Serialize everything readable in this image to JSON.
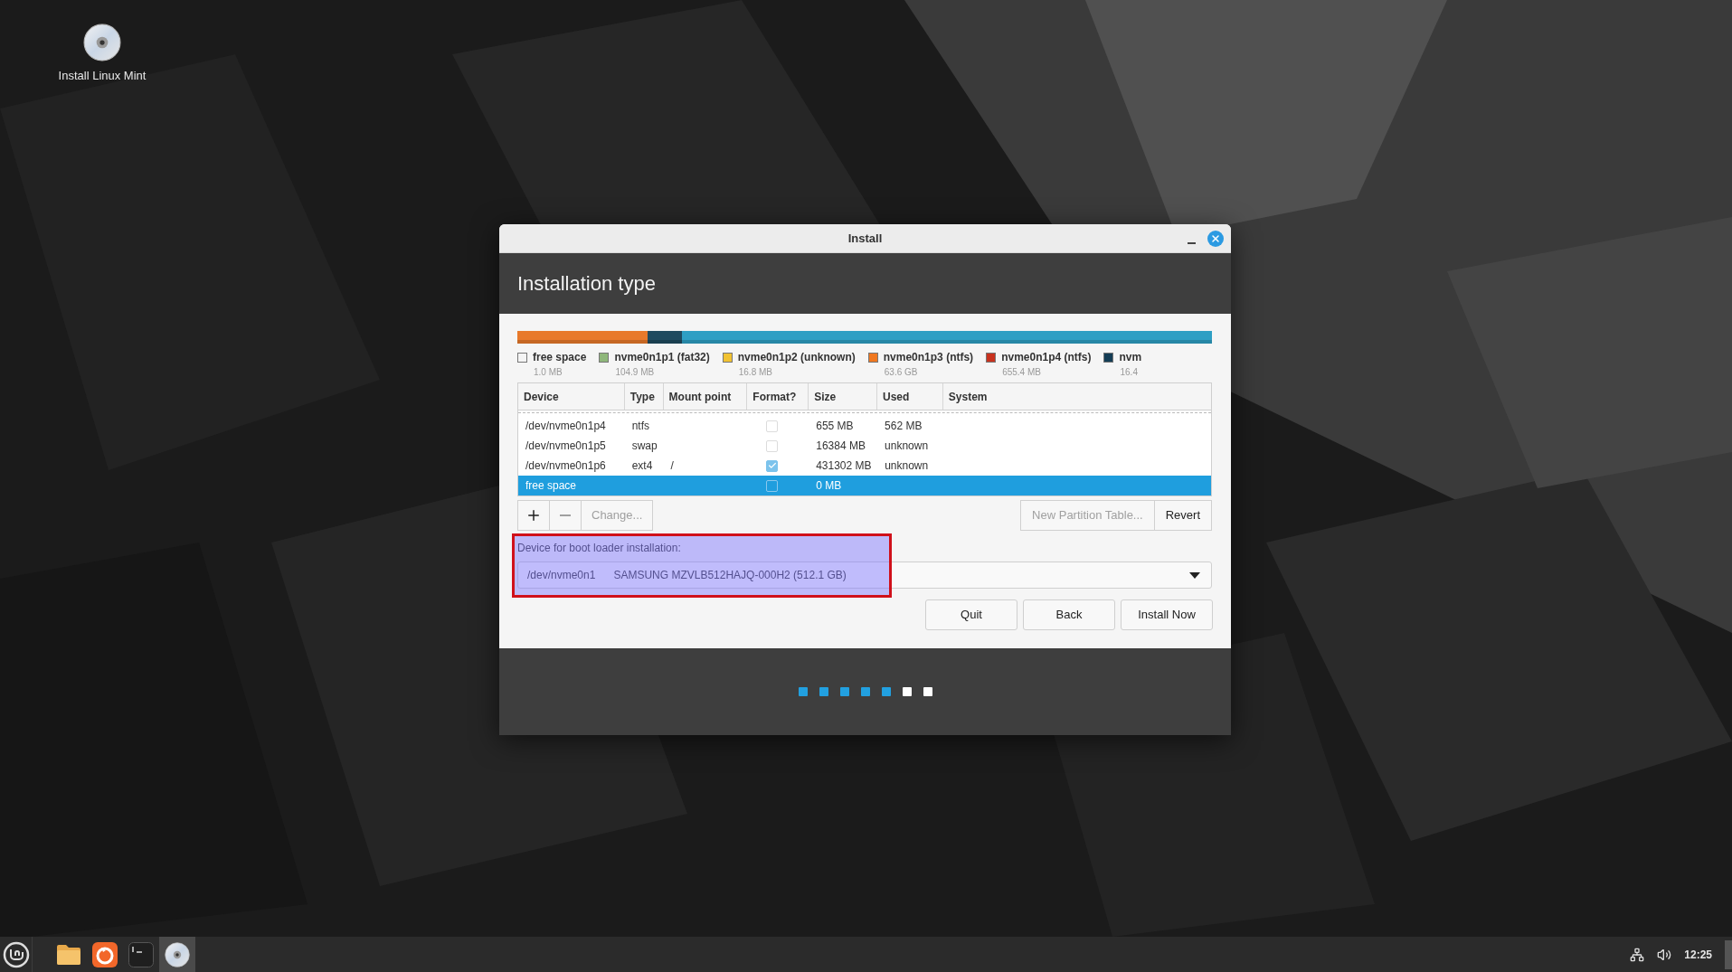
{
  "desktop": {
    "icons": [
      {
        "label": "Install Linux Mint"
      }
    ]
  },
  "window": {
    "title": "Install",
    "heading": "Installation type"
  },
  "legend": [
    {
      "name": "free space",
      "size": "1.0 MB",
      "color": "#f4f4f4"
    },
    {
      "name": "nvme0n1p1 (fat32)",
      "size": "104.9 MB",
      "color": "#8fb77b"
    },
    {
      "name": "nvme0n1p2 (unknown)",
      "size": "16.8 MB",
      "color": "#f1c232"
    },
    {
      "name": "nvme0n1p3 (ntfs)",
      "size": "63.6 GB",
      "color": "#f07820"
    },
    {
      "name": "nvme0n1p4 (ntfs)",
      "size": "655.4 MB",
      "color": "#c8321e"
    },
    {
      "name": "nvm",
      "size": "16.4",
      "color": "#143d55"
    }
  ],
  "table": {
    "columns": [
      "Device",
      "Type",
      "Mount point",
      "Format?",
      "Size",
      "Used",
      "System"
    ],
    "rows": [
      {
        "device": "/dev/nvme0n1p4",
        "type": "ntfs",
        "format": false,
        "size": "655 MB",
        "used": "562 MB",
        "selected": false
      },
      {
        "device": "/dev/nvme0n1p5",
        "type": "swap",
        "format": false,
        "size": "16384 MB",
        "used": "unknown",
        "selected": false
      },
      {
        "device": "/dev/nvme0n1p6",
        "type": "ext4",
        "mount_point": "/",
        "format": true,
        "size": "431302 MB",
        "used": "unknown",
        "selected": false
      },
      {
        "device": "free space",
        "format": false,
        "size": "0 MB",
        "selected": true
      }
    ]
  },
  "partition_tools": [
    {
      "kind": "add",
      "disabled": false
    },
    {
      "kind": "remove",
      "disabled": true
    },
    {
      "kind": "text",
      "label": "Change...",
      "disabled": true
    }
  ],
  "table_buttons": [
    {
      "label": "New Partition Table...",
      "disabled": true
    },
    {
      "label": "Revert",
      "disabled": false
    }
  ],
  "boot_loader": {
    "label": "Device for boot loader installation:",
    "device": "/dev/nvme0n1",
    "description": "SAMSUNG MZVLB512HAJQ-000H2 (512.1 GB)",
    "highlighted": true
  },
  "actions": [
    {
      "label": "Quit"
    },
    {
      "label": "Back"
    },
    {
      "label": "Install Now"
    }
  ],
  "steps": [
    {
      "done": true
    },
    {
      "done": true
    },
    {
      "done": true
    },
    {
      "done": true
    },
    {
      "done": true
    },
    {
      "done": false
    },
    {
      "done": false
    }
  ],
  "taskbar": {
    "apps": [
      {
        "kind": "files",
        "active": false
      },
      {
        "kind": "browser",
        "active": false
      },
      {
        "kind": "terminal",
        "active": false
      },
      {
        "kind": "disc",
        "active": true
      }
    ],
    "clock": "12:25"
  }
}
